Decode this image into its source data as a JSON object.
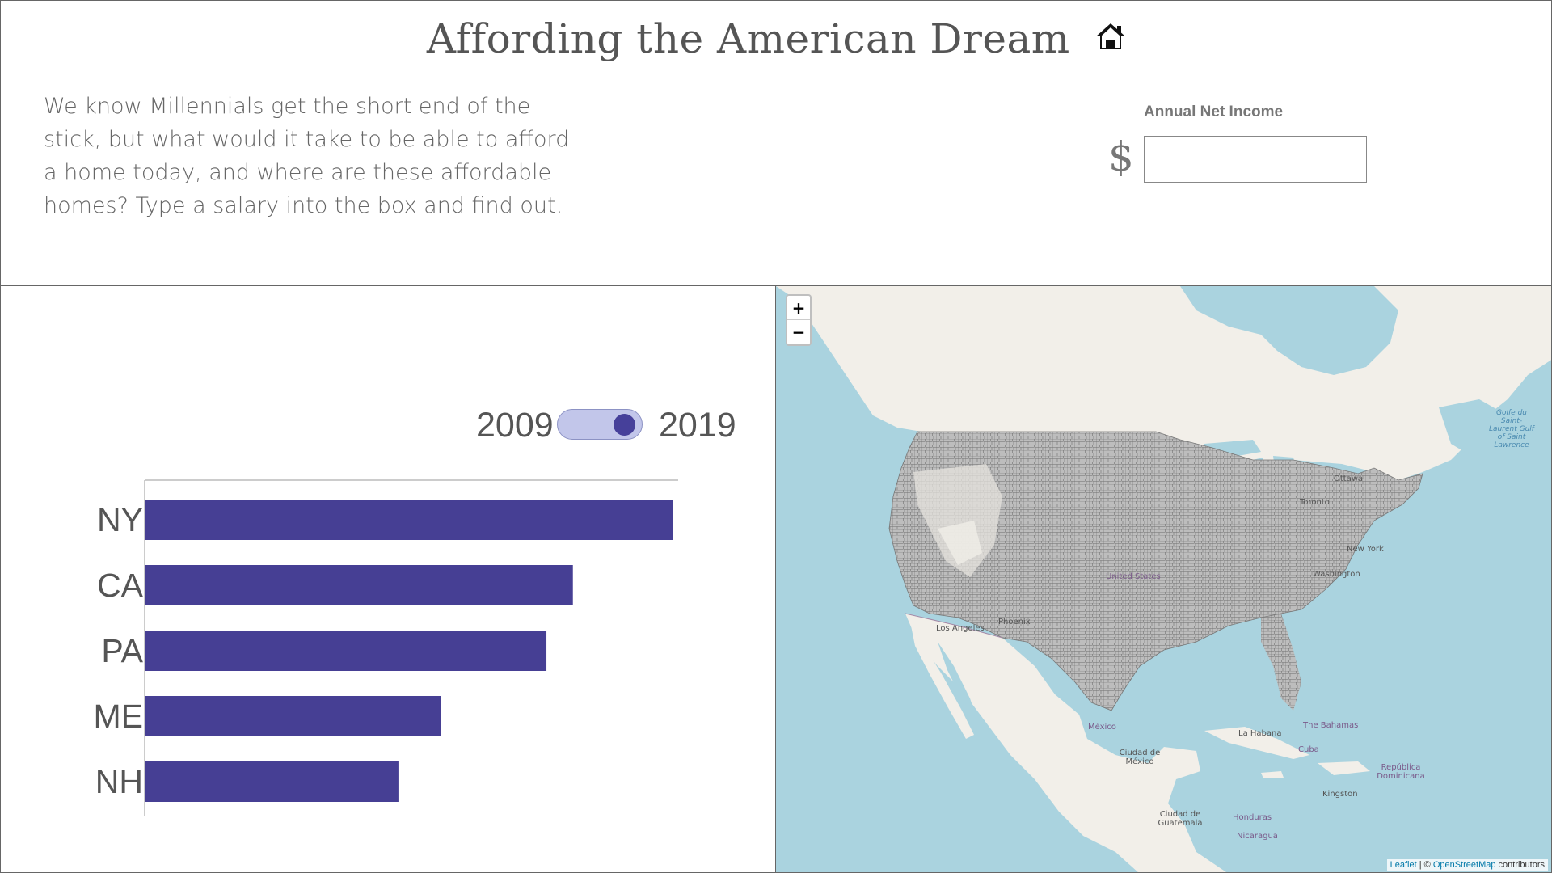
{
  "header": {
    "title": "Affording the American Dream",
    "intro": "We know Millennials get the short end of the stick, but what would it take to be able to afford a home today, and where are these affordable homes? Type a salary into the box and find out.",
    "income_label": "Annual Net Income",
    "currency_symbol": "$",
    "income_value": "",
    "house_icon": "home-icon"
  },
  "toggle": {
    "left_year": "2009",
    "right_year": "2019",
    "selected": "2019"
  },
  "colors": {
    "bar": "#463f94",
    "toggle_track": "#c2c6ea",
    "water": "#aad3df",
    "land": "#f2efe9",
    "county": "#8a8a8a"
  },
  "chart_data": {
    "type": "bar",
    "orientation": "horizontal",
    "categories": [
      "NY",
      "CA",
      "PA",
      "ME",
      "NH"
    ],
    "values": [
      100,
      81,
      76,
      56,
      48
    ],
    "xlim": [
      0,
      100
    ],
    "title": "",
    "xlabel": "",
    "ylabel": ""
  },
  "map": {
    "zoom_in": "+",
    "zoom_out": "−",
    "attribution_leaflet": "Leaflet",
    "attribution_sep": " | © ",
    "attribution_osm": "OpenStreetMap",
    "attribution_tail": " contributors",
    "labels": {
      "ottawa": "Ottawa",
      "toronto": "Toronto",
      "new_york": "New York",
      "washington": "Washington",
      "united_states": "United States",
      "los_angeles": "Los Angeles",
      "phoenix": "Phoenix",
      "mexico": "México",
      "ciudad_mexico": "Ciudad de México",
      "la_habana": "La Habana",
      "bahamas": "The Bahamas",
      "cuba": "Cuba",
      "republica_dominicana": "República Dominicana",
      "kingston": "Kingston",
      "honduras": "Honduras",
      "nicaragua": "Nicaragua",
      "guatemala": "Ciudad de Guatemala",
      "golfe": "Golfe du Saint-Laurent Gulf of Saint Lawrence"
    }
  }
}
